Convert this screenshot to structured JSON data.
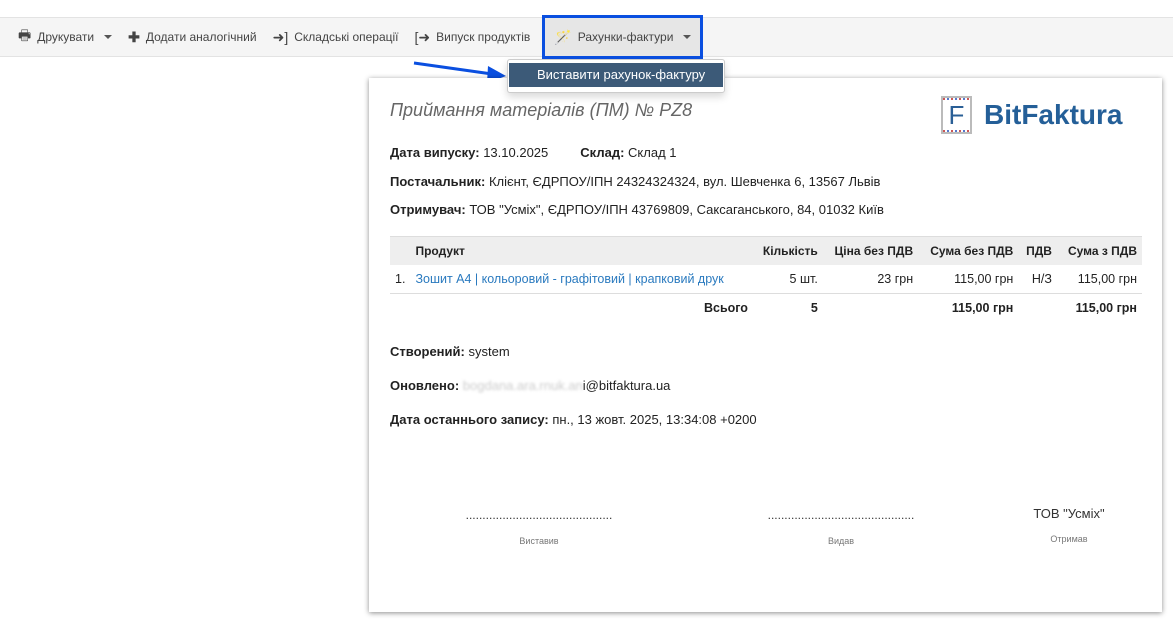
{
  "toolbar": {
    "items": [
      {
        "label": "Друкувати",
        "icon": "printer-icon"
      },
      {
        "label": "Додати аналогічний",
        "icon": "plus-icon"
      },
      {
        "label": "Складські операції",
        "icon": "sign-in-icon"
      },
      {
        "label": "Випуск продуктів",
        "icon": "sign-out-icon"
      },
      {
        "label": "Рахунки-фактури",
        "icon": "magic-wand-icon"
      }
    ]
  },
  "menu": {
    "item": "Виставити рахунок-фактуру"
  },
  "doc": {
    "title": "Приймання матеріалів (ПМ) № PZ8",
    "logo": "BitFaktura",
    "issue_label": "Дата випуску:",
    "issue": "13.10.2025",
    "warehouse_label": "Склад:",
    "warehouse": "Склад 1",
    "supplier_label": "Постачальник:",
    "supplier": "Клієнт, ЄДРПОУ/ІПН 24324324324, вул. Шевченка 6, 13567 Львів",
    "recipient_label": "Отримувач:",
    "recipient": "ТОВ \"Усміх\", ЄДРПОУ/ІПН 43769809, Саксаганського, 84, 01032 Київ",
    "table": {
      "headers": [
        "",
        "Продукт",
        "Кількість",
        "Ціна без ПДВ",
        "Сума без ПДВ",
        "ПДВ",
        "Сума з ПДВ"
      ],
      "rows": [
        [
          "1.",
          "Зошит А4 | кольоровий - графітовий | крапковий друк",
          "5 шт.",
          "23 грн",
          "115,00 грн",
          "Н/З",
          "115,00 грн"
        ]
      ],
      "total": {
        "label": "Всього",
        "qty": "5",
        "net": "115,00 грн",
        "gross": "115,00 грн"
      }
    },
    "created_label": "Створений:",
    "created": "system",
    "updated_label": "Оновлено:",
    "updated": "i@bitfaktura.ua",
    "last_label": "Дата останнього запису:",
    "last": "пн., 13 жовт. 2025, 13:34:08 +0200",
    "sig": {
      "dots": "............................................",
      "issued": "Виставив",
      "given": "Видав",
      "received_name": "ТОВ \"Усміх\"",
      "received": "Отримав"
    }
  }
}
